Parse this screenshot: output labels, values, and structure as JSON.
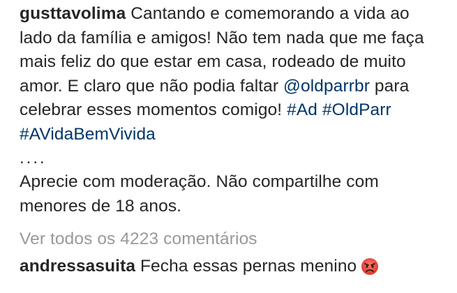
{
  "caption": {
    "username": "gusttavolima",
    "line1_text": " Cantando e comemorando a vida ao",
    "line2": "lado da família e amigos! Não tem nada que me faça",
    "line3": "mais feliz do que estar em casa, rodeado de muito",
    "line4_text": "amor. E claro que não podia faltar ",
    "mention": "@oldparrbr",
    "line4_after": " para",
    "line5_text": "celebrar esses momentos comigo! ",
    "hashtag_ad": "#Ad",
    "hashtag_oldparr": "#OldParr",
    "hashtag_avidabemvivida": "#AVidaBemVivida",
    "dots": "....",
    "disclaimer_line1": "Aprecie com moderação. Não compartilhe com",
    "disclaimer_line2": "menores de 18 anos."
  },
  "comments": {
    "view_all": "Ver todos os 4223 comentários",
    "first": {
      "username": "andressasuita",
      "text": " Fecha essas pernas menino",
      "emoji": "angry-face-icon"
    }
  },
  "colors": {
    "text": "#262626",
    "link": "#003569",
    "muted": "#999999",
    "emoji_face": "#e8453c"
  }
}
